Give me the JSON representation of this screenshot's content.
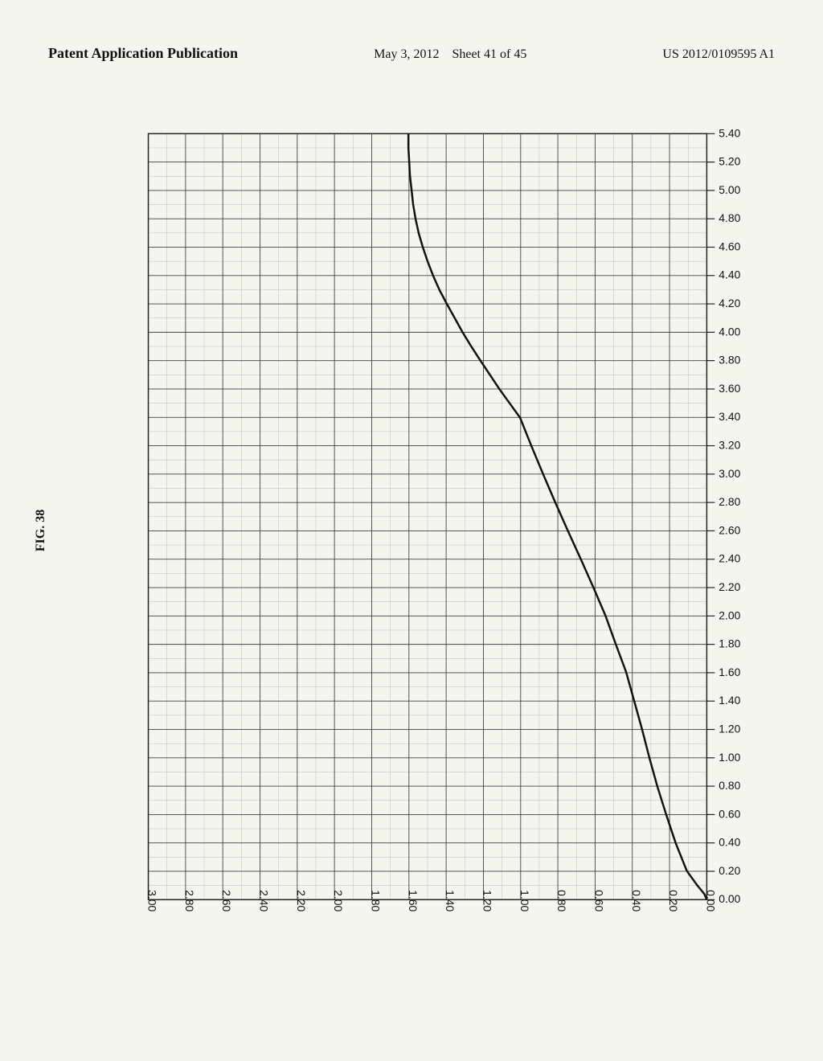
{
  "header": {
    "left_line1": "Patent Application Publication",
    "center": "May 3, 2012",
    "sheet_info": "Sheet 41 of 45",
    "patent_num": "US 2012/0109595 A1"
  },
  "fig_label": "FIG. 38",
  "chart": {
    "y_axis_labels": [
      "0.00",
      "0.20",
      "0.40",
      "0.60",
      "0.80",
      "1.00",
      "1.20",
      "1.40",
      "1.60",
      "1.80",
      "2.00",
      "2.20",
      "2.40",
      "2.60",
      "2.80",
      "3.00",
      "3.20",
      "3.40",
      "3.60",
      "3.80",
      "4.00",
      "4.20",
      "4.40",
      "4.60",
      "4.80",
      "5.00",
      "5.20",
      "5.40"
    ],
    "x_axis_labels": [
      "0.00",
      "0.20",
      "0.40",
      "0.60",
      "0.80",
      "1.00",
      "1.20",
      "1.40",
      "1.60",
      "1.80",
      "2.00",
      "2.20",
      "2.40",
      "2.60",
      "2.80",
      "3.00"
    ]
  }
}
